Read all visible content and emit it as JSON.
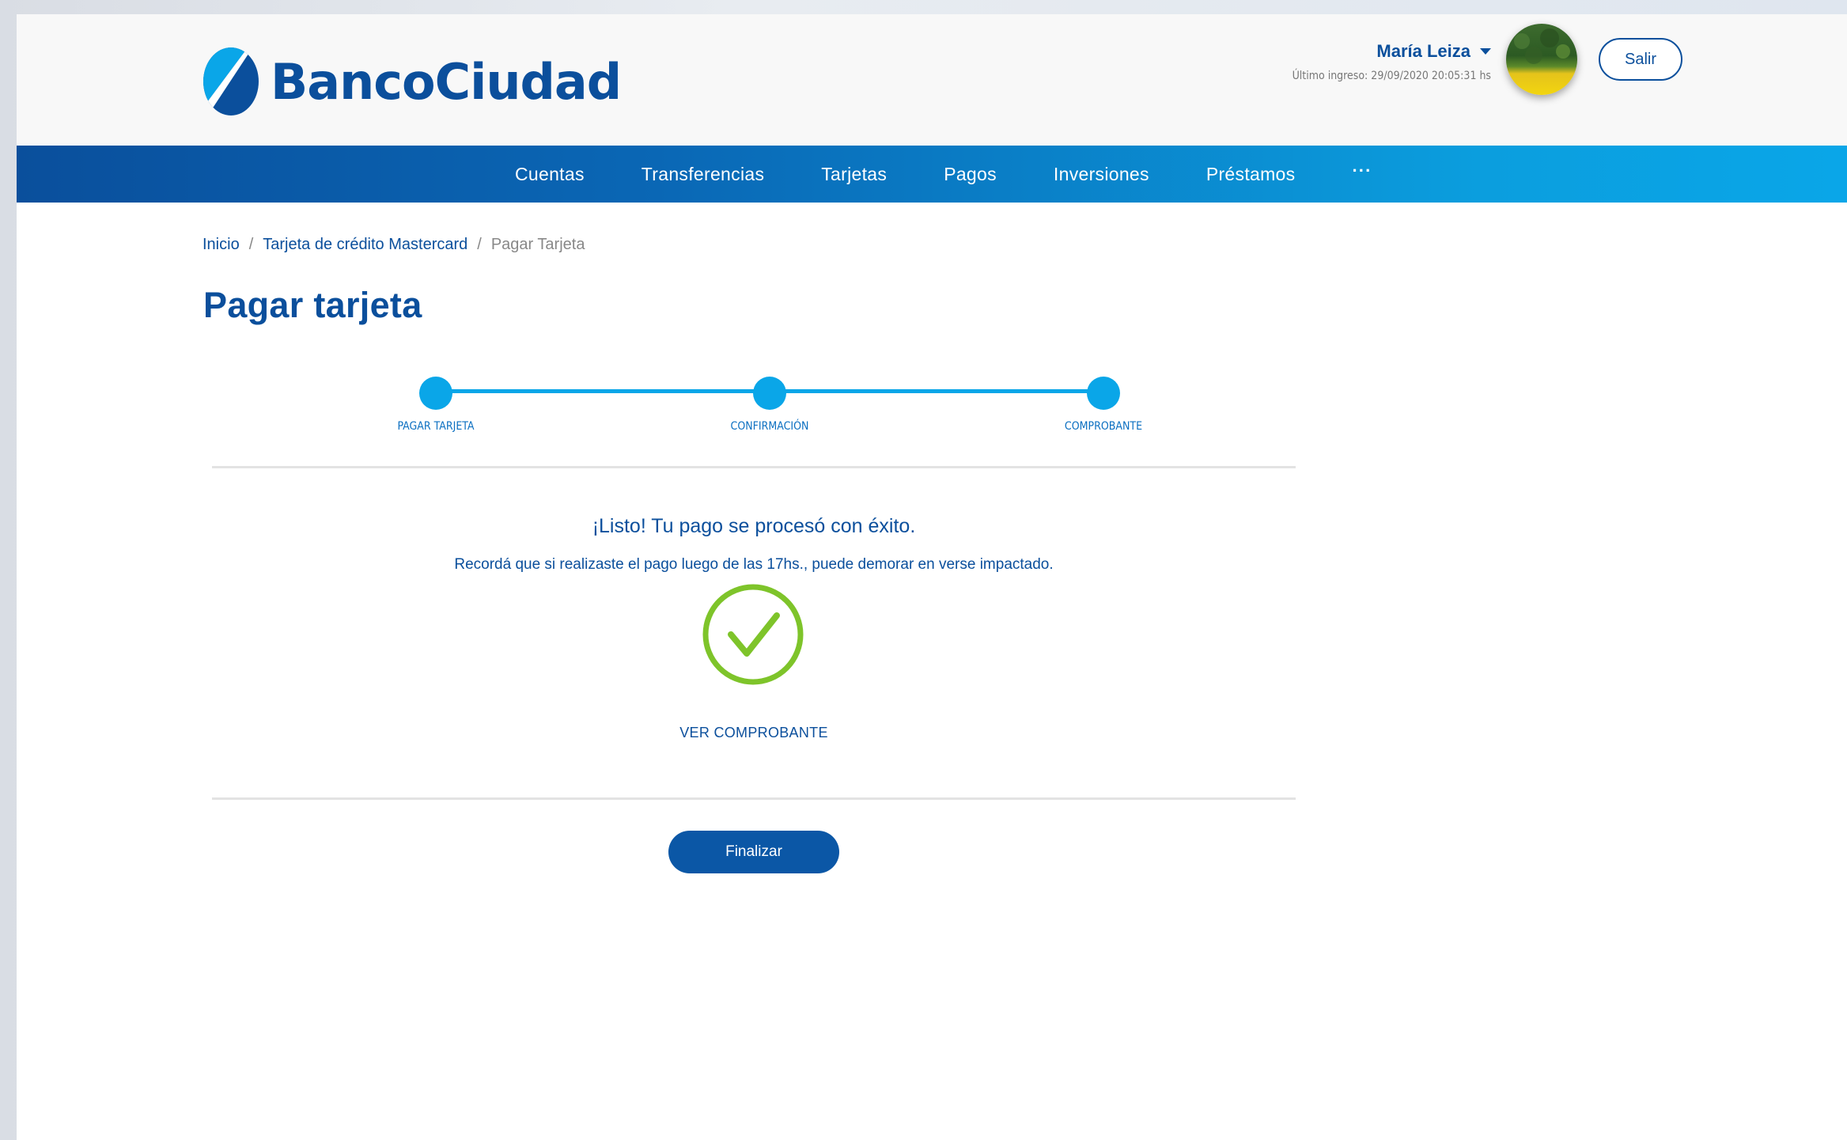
{
  "header": {
    "logo_text": "BancoCiudad",
    "user_name": "María Leiza",
    "last_login": "Último ingreso: 29/09/2020 20:05:31 hs",
    "logout_label": "Salir"
  },
  "nav": {
    "items": [
      {
        "label": "Cuentas"
      },
      {
        "label": "Transferencias"
      },
      {
        "label": "Tarjetas"
      },
      {
        "label": "Pagos"
      },
      {
        "label": "Inversiones"
      },
      {
        "label": "Préstamos"
      }
    ],
    "more_label": "···"
  },
  "breadcrumb": {
    "home": "Inicio",
    "card": "Tarjeta de crédito Mastercard",
    "current": "Pagar Tarjeta",
    "separator": "/"
  },
  "page": {
    "title": "Pagar tarjeta"
  },
  "stepper": {
    "steps": [
      {
        "label": "PAGAR TARJETA"
      },
      {
        "label": "CONFIRMACIÓN"
      },
      {
        "label": "COMPROBANTE"
      }
    ]
  },
  "result": {
    "title": "¡Listo! Tu pago se procesó con éxito.",
    "note": "Recordá que si realizaste el pago luego de las 17hs., puede demorar en verse impactado.",
    "view_receipt": "VER COMPROBANTE",
    "icon": "success-check-icon"
  },
  "actions": {
    "finish_label": "Finalizar"
  },
  "colors": {
    "brand_blue": "#0b4f9c",
    "accent_cyan": "#0aa6e8",
    "success_green": "#7ec42a"
  }
}
